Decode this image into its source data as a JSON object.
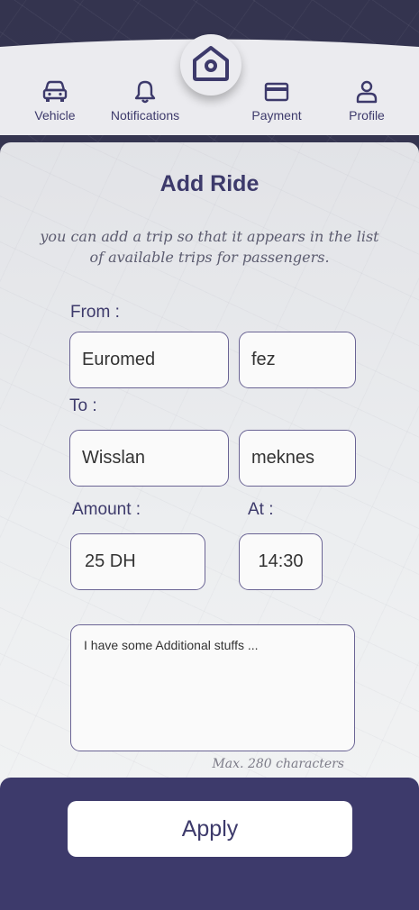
{
  "nav": {
    "items": [
      {
        "label": "Vehicle",
        "icon": "car-icon"
      },
      {
        "label": "Notifications",
        "icon": "bell-icon"
      },
      {
        "label": "Payment",
        "icon": "credit-card-icon"
      },
      {
        "label": "Profile",
        "icon": "user-icon"
      }
    ],
    "home_icon": "home-icon"
  },
  "form": {
    "title": "Add Ride",
    "subtitle_line1": "you can add a trip so that it appears in the list",
    "subtitle_line2": "of available trips for passengers.",
    "from_label": "From :",
    "from_place": "Euromed",
    "from_city": "fez",
    "to_label": "To :",
    "to_place": "Wisslan",
    "to_city": "meknes",
    "amount_label": "Amount :",
    "amount_value": "25 DH",
    "at_label": "At :",
    "at_value": "14:30",
    "notes_value": "I have some Additional stuffs ...",
    "max_chars": "Max. 280 characters"
  },
  "footer": {
    "apply_label": "Apply"
  },
  "colors": {
    "primary": "#3d3a6b",
    "field_border": "#6a6494",
    "card_bg": "#e6e7ea"
  }
}
